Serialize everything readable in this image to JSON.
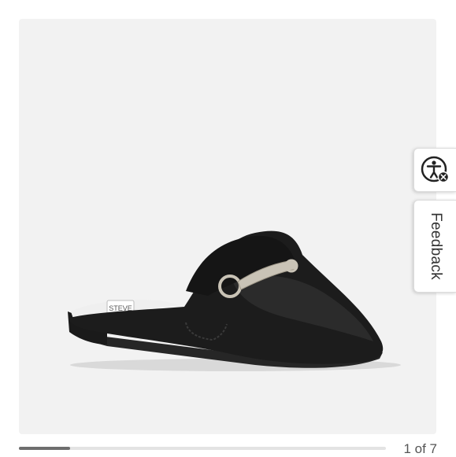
{
  "product_image": {
    "alt": "",
    "brand_insole_text": "STEVE"
  },
  "accessibility_button": {
    "icon": "accessibility-icon"
  },
  "feedback_tab": {
    "label": "Feedback"
  },
  "gallery": {
    "current": 1,
    "total": 7,
    "counter_text": "1 of 7",
    "progress_fraction": 0.14
  },
  "colors": {
    "background": "#ffffff",
    "image_bg": "#f2f2f2",
    "progress_track": "#e3e3e3",
    "progress_fill": "#6e6e6e",
    "shoe": "#1c1c1c",
    "hardware": "#c9c3b6"
  }
}
